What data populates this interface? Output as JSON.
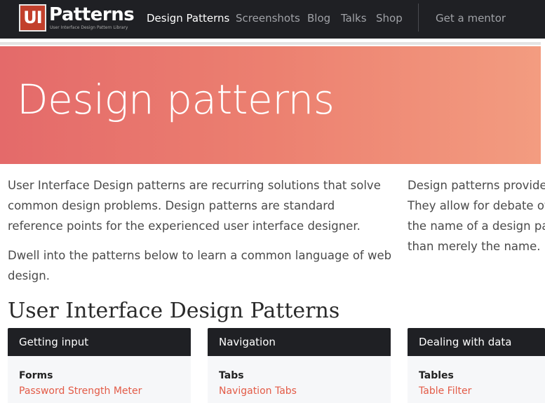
{
  "header": {
    "logo_badge": "UI",
    "logo_word": "Patterns",
    "logo_tagline": "User Interface Design Pattern Library",
    "nav": [
      {
        "label": "Design Patterns",
        "active": true
      },
      {
        "label": "Screenshots",
        "active": false
      },
      {
        "label": "Blog",
        "active": false
      },
      {
        "label": "Talks",
        "active": false
      },
      {
        "label": "Shop",
        "active": false
      },
      {
        "label": "Get a mentor",
        "active": false
      }
    ]
  },
  "hero": {
    "title": "Design patterns"
  },
  "intro": {
    "left_p1": "User Interface Design patterns are recurring solutions that solve common design problems. Design patterns are standard reference points for the experienced user interface designer.",
    "left_p2": "Dwell into the patterns below to learn a common language of web design.",
    "right_lines": [
      "Design patterns provide",
      "They allow for debate ov",
      "the name of a design pat",
      "than merely the name."
    ]
  },
  "section": {
    "heading": "User Interface Design Patterns"
  },
  "cards": [
    {
      "header": "Getting input",
      "title": "Forms",
      "link": "Password Strength Meter"
    },
    {
      "header": "Navigation",
      "title": "Tabs",
      "link": "Navigation Tabs"
    },
    {
      "header": "Dealing with data",
      "title": "Tables",
      "link": "Table Filter"
    }
  ],
  "colors": {
    "topbar": "#1f2024",
    "accent_link": "#e35b47",
    "hero_start": "#e46a6a",
    "hero_end": "#f39c80"
  }
}
